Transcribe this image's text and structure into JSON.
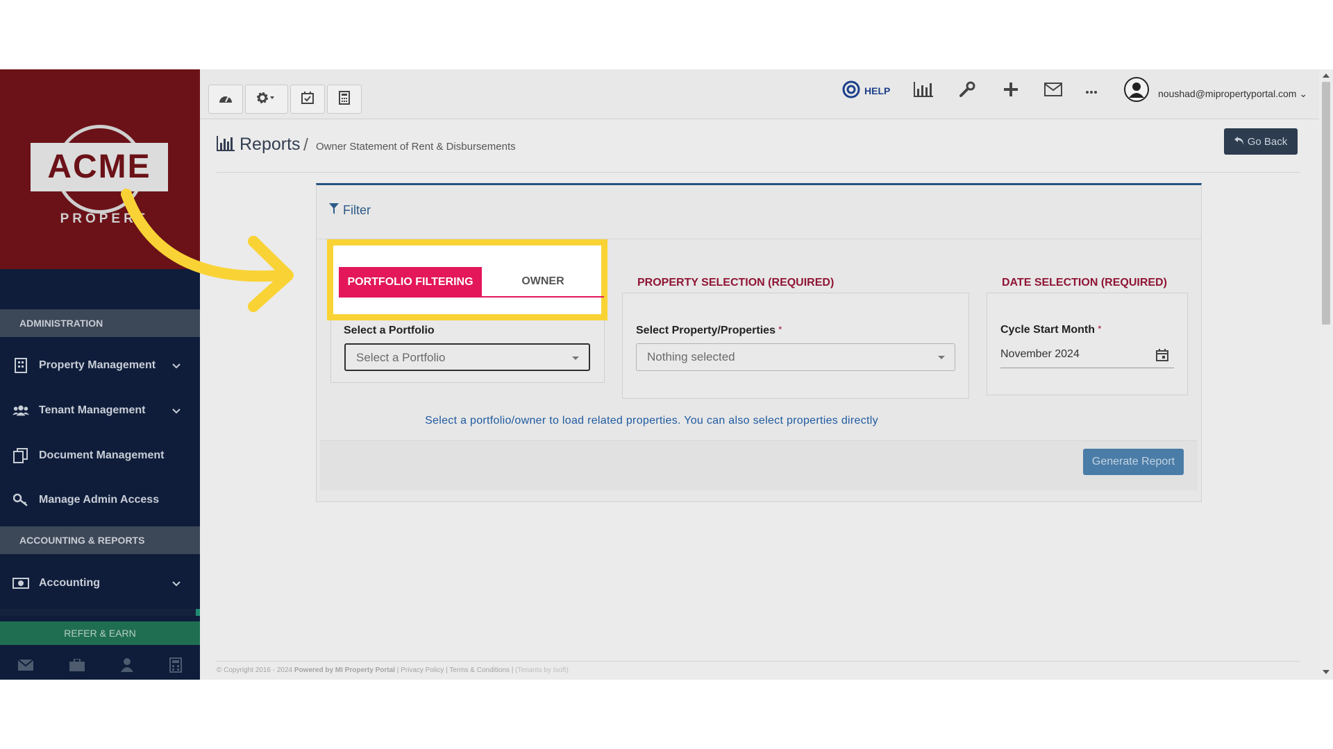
{
  "sidebar": {
    "logo_text": "ACME",
    "logo_sub": "PROPERT",
    "sections": [
      "ADMINISTRATION",
      "ACCOUNTING & REPORTS"
    ],
    "items": [
      {
        "label": "Property Management",
        "icon": "building-icon",
        "expandable": true
      },
      {
        "label": "Tenant Management",
        "icon": "users-icon",
        "expandable": true
      },
      {
        "label": "Document Management",
        "icon": "documents-icon",
        "expandable": false
      },
      {
        "label": "Manage Admin Access",
        "icon": "key-icon",
        "expandable": false
      },
      {
        "label": "Accounting",
        "icon": "money-icon",
        "expandable": true
      }
    ],
    "refer_label": "REFER & EARN",
    "bottom_icons": [
      "mail-icon",
      "briefcase-icon",
      "user-icon",
      "calculator-icon"
    ]
  },
  "topbar": {
    "left_buttons": [
      "dashboard-icon",
      "settings-icon",
      "calendar-check-icon",
      "calculator-icon"
    ],
    "help_label": "HELP",
    "right_icons": [
      "bar-chart-icon",
      "wrench-icon",
      "plus-icon",
      "envelope-icon",
      "more-icon"
    ],
    "user_email": "noushad@mipropertyportal.com"
  },
  "header": {
    "title": "Reports",
    "separator": "/",
    "subtitle": "Owner Statement of Rent & Disbursements",
    "go_back_label": "Go Back"
  },
  "filter": {
    "title": "Filter",
    "tabs": [
      {
        "label": "PORTFOLIO FILTERING",
        "active": true
      },
      {
        "label": "OWNER",
        "active": false
      }
    ],
    "portfolio": {
      "label": "Select a Portfolio",
      "placeholder": "Select a Portfolio"
    },
    "property_section": "PROPERTY SELECTION (REQUIRED)",
    "property": {
      "label": "Select Property/Properties",
      "required_mark": "*",
      "value": "Nothing selected"
    },
    "date_section": "DATE SELECTION (REQUIRED)",
    "date": {
      "label": "Cycle Start Month",
      "required_mark": "*",
      "value": "November 2024"
    },
    "hint": "Select a portfolio/owner to load related properties. You can also select properties directly",
    "generate_label": "Generate Report"
  },
  "footer": {
    "copyright": "© Copyright 2016 - 2024",
    "powered": "Powered by MI Property Portal",
    "links": "| Privacy Policy | Terms & Conditions |",
    "tenants_note": "(Tenants by Isoft)"
  },
  "colors": {
    "accent_pink": "#e3175a",
    "highlight_yellow": "#f9d335",
    "sidebar_navy": "#0f1d3b",
    "logo_red": "#6b1218",
    "refer_green": "#1f6e52"
  }
}
